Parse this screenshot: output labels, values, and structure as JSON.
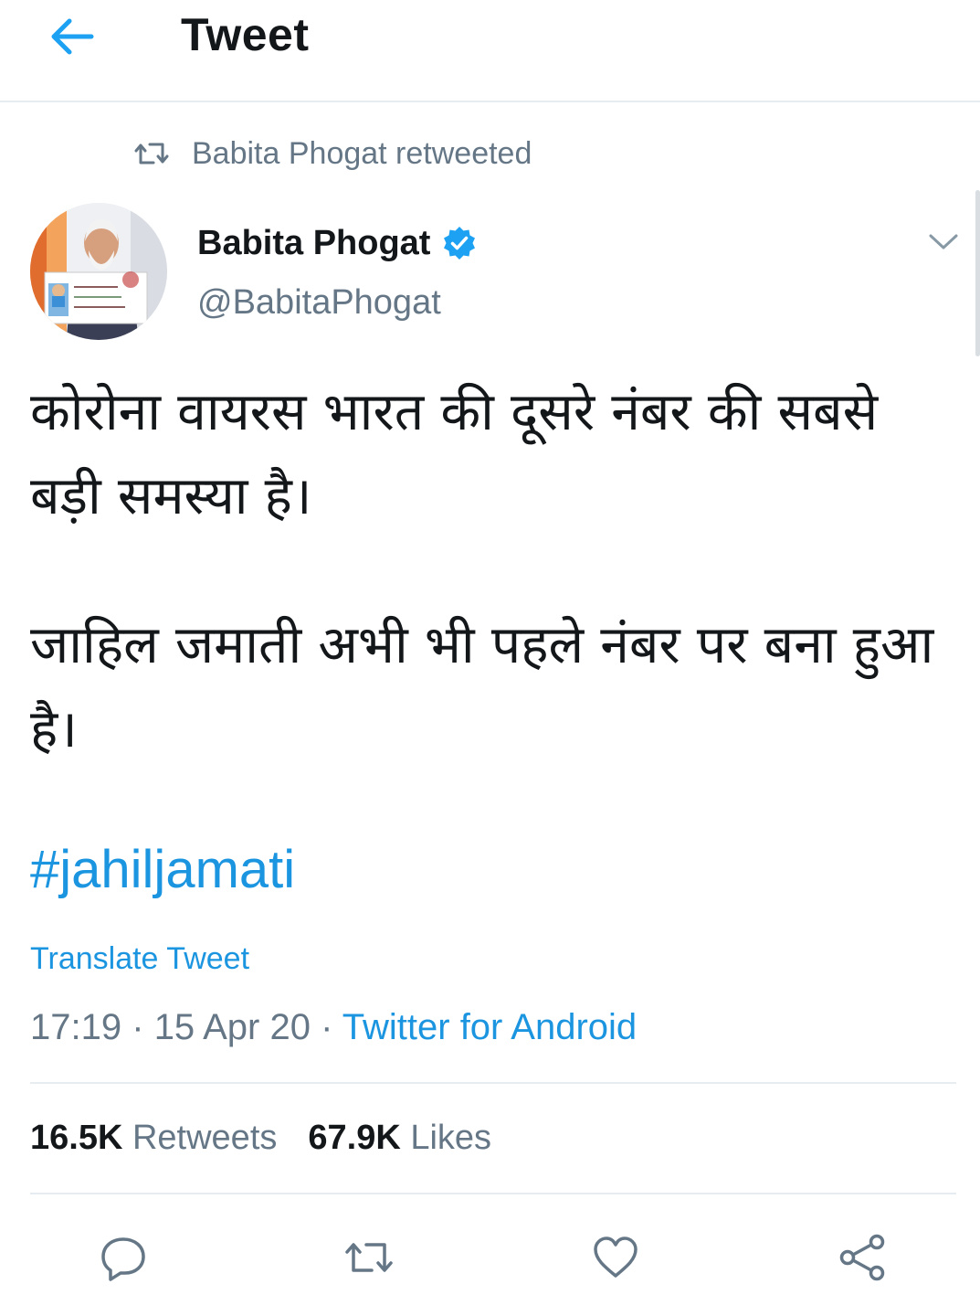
{
  "header": {
    "title": "Tweet",
    "back_icon": "arrow-left-icon"
  },
  "retweet_context": {
    "text": "Babita Phogat retweeted",
    "icon": "retweet-icon"
  },
  "author": {
    "name": "Babita Phogat",
    "handle": "@BabitaPhogat",
    "verified": true
  },
  "tweet": {
    "paragraphs": [
      "कोरोना वायरस भारत की दूसरे नंबर की सबसे बड़ी समस्या है।",
      "जाहिल जमाती अभी भी पहले नंबर पर बना हुआ है।"
    ],
    "hashtag": "#jahiljamati",
    "translate_label": "Translate Tweet",
    "time": "17:19",
    "separator": "·",
    "date": "15 Apr 20",
    "source": "Twitter for Android"
  },
  "stats": {
    "retweets_count": "16.5K",
    "retweets_label": "Retweets",
    "likes_count": "67.9K",
    "likes_label": "Likes"
  },
  "colors": {
    "accent": "#1b95e0",
    "muted": "#657786",
    "text": "#14171a",
    "divider": "#e6ecf0",
    "verified": "#1da1f2"
  },
  "actions": [
    "reply-icon",
    "retweet-icon",
    "like-icon",
    "share-icon"
  ]
}
